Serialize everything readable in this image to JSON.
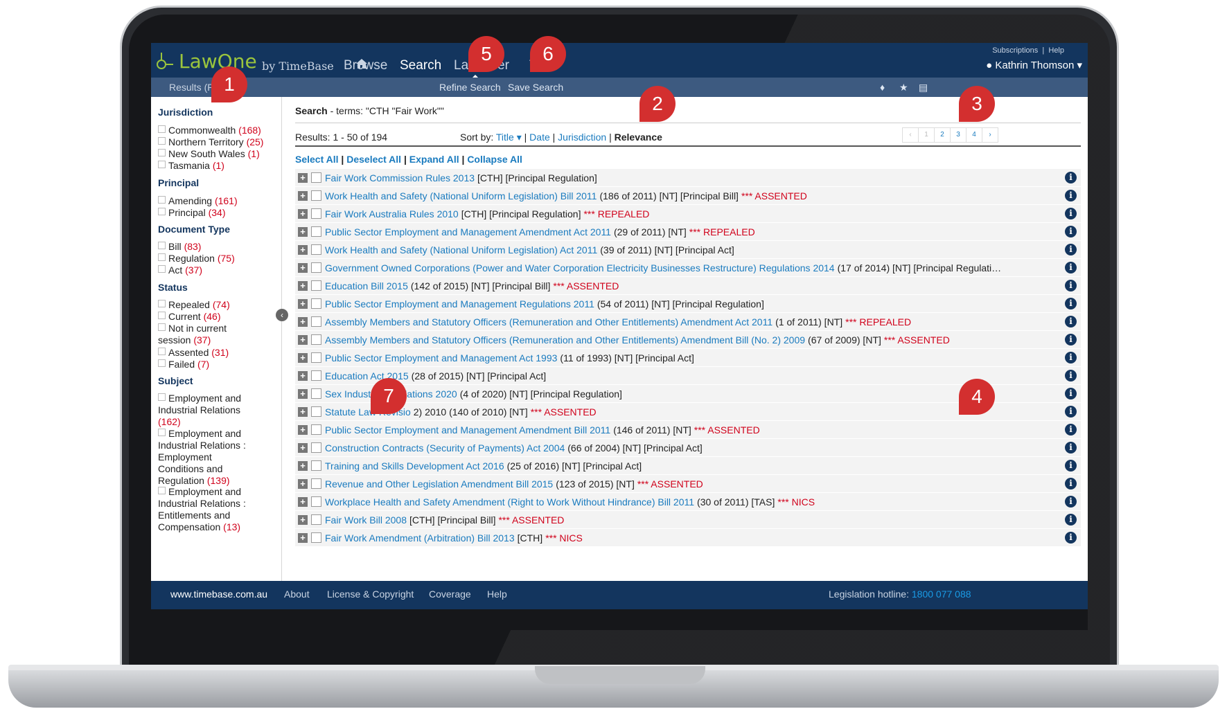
{
  "app": {
    "logo_text": "LawOne",
    "logo_by": "by TimeBase"
  },
  "nav": {
    "items": [
      {
        "label": "Browse"
      },
      {
        "label": "Search"
      },
      {
        "label": "Law"
      },
      {
        "label": "er"
      },
      {
        "label": "T"
      }
    ]
  },
  "toplinks": {
    "subscriptions": "Subscriptions",
    "separator": "|",
    "help": "Help",
    "user": "Kathrin Thomson"
  },
  "subbar": {
    "crumb": "Results (Page 1",
    "refine": "Refine Search",
    "save": "Save Search"
  },
  "sidebar": {
    "groups": [
      {
        "heading": "Jurisdiction",
        "items": [
          {
            "label": "Commonwealth",
            "count": "(168)"
          },
          {
            "label": "Northern Territory",
            "count": "(25)"
          },
          {
            "label": "New South Wales",
            "count": "(1)"
          },
          {
            "label": "Tasmania",
            "count": "(1)"
          }
        ]
      },
      {
        "heading": "Principal",
        "items": [
          {
            "label": "Amending",
            "count": "(161)"
          },
          {
            "label": "Principal",
            "count": "(34)"
          }
        ]
      },
      {
        "heading": "Document Type",
        "items": [
          {
            "label": "Bill",
            "count": "(83)"
          },
          {
            "label": "Regulation",
            "count": "(75)"
          },
          {
            "label": "Act",
            "count": "(37)"
          }
        ]
      },
      {
        "heading": "Status",
        "items": [
          {
            "label": "Repealed",
            "count": "(74)"
          },
          {
            "label": "Current",
            "count": "(46)"
          },
          {
            "label": "Not in current session",
            "count": "(37)"
          },
          {
            "label": "Assented",
            "count": "(31)"
          },
          {
            "label": "Failed",
            "count": "(7)"
          }
        ]
      },
      {
        "heading": "Subject",
        "items": [
          {
            "label": "Employment and Industrial Relations",
            "count": "(162)"
          },
          {
            "label": "Employment and Industrial Relations : Employment Conditions and Regulation",
            "count": "(139)"
          },
          {
            "label": "Employment and Industrial Relations : Entitlements and Compensation",
            "count": "(13)"
          }
        ]
      }
    ]
  },
  "main": {
    "search_label": "Search",
    "search_terms": " - terms: \"CTH \"Fair Work\"\"",
    "results": "Results: 1 - 50 of 194",
    "sort_label": "Sort by:",
    "sort_title": "Title",
    "sort_date": "Date",
    "sort_jurisdiction": "Jurisdiction",
    "sort_relevance": "Relevance",
    "pages": [
      "‹",
      "1",
      "2",
      "3",
      "4",
      "›"
    ],
    "select_all": "Select All",
    "deselect_all": "Deselect All",
    "expand_all": "Expand All",
    "collapse_all": "Collapse All",
    "rows": [
      {
        "title": "Fair Work Commission Rules 2013",
        "meta": "[CTH] [Principal Regulation]",
        "flag": ""
      },
      {
        "title": "Work Health and Safety (National Uniform Legislation) Bill 2011",
        "meta": "(186 of 2011) [NT] [Principal Bill]",
        "flag": "*** ASSENTED"
      },
      {
        "title": "Fair Work Australia Rules 2010",
        "meta": "[CTH] [Principal Regulation]",
        "flag": "*** REPEALED"
      },
      {
        "title": "Public Sector Employment and Management Amendment Act 2011",
        "meta": "(29 of 2011) [NT]",
        "flag": "*** REPEALED"
      },
      {
        "title": "Work Health and Safety (National Uniform Legislation) Act 2011",
        "meta": "(39 of 2011) [NT] [Principal Act]",
        "flag": ""
      },
      {
        "title": "Government Owned Corporations (Power and Water Corporation Electricity Businesses Restructure) Regulations 2014",
        "meta": "(17 of 2014) [NT] [Principal Regulati…",
        "flag": ""
      },
      {
        "title": "Education Bill 2015",
        "meta": "(142 of 2015) [NT] [Principal Bill]",
        "flag": "*** ASSENTED"
      },
      {
        "title": "Public Sector Employment and Management Regulations 2011",
        "meta": "(54 of 2011) [NT] [Principal Regulation]",
        "flag": ""
      },
      {
        "title": "Assembly Members and Statutory Officers (Remuneration and Other Entitlements) Amendment Act 2011",
        "meta": "(1 of 2011) [NT]",
        "flag": "*** REPEALED"
      },
      {
        "title": "Assembly Members and Statutory Officers (Remuneration and Other Entitlements) Amendment Bill (No. 2) 2009",
        "meta": "(67 of 2009) [NT]",
        "flag": "*** ASSENTED"
      },
      {
        "title": "Public Sector Employment and Management Act 1993",
        "meta": "(11 of 1993) [NT] [Principal Act]",
        "flag": ""
      },
      {
        "title": "Education Act 2015",
        "meta": "(28 of 2015) [NT] [Principal Act]",
        "flag": ""
      },
      {
        "title": "Sex Industry Regulations 2020",
        "meta": "(4 of 2020) [NT] [Principal Regulation]",
        "flag": ""
      },
      {
        "title": "Statute Law Revisio",
        "meta": "2) 2010 (140 of 2010) [NT]",
        "flag": "*** ASSENTED"
      },
      {
        "title": "Public Sector Employment and Management Amendment Bill 2011",
        "meta": "(146 of 2011) [NT]",
        "flag": "*** ASSENTED"
      },
      {
        "title": "Construction Contracts (Security of Payments) Act 2004",
        "meta": "(66 of 2004) [NT] [Principal Act]",
        "flag": ""
      },
      {
        "title": "Training and Skills Development Act 2016",
        "meta": "(25 of 2016) [NT] [Principal Act]",
        "flag": ""
      },
      {
        "title": "Revenue and Other Legislation Amendment Bill 2015",
        "meta": "(123 of 2015) [NT]",
        "flag": "*** ASSENTED"
      },
      {
        "title": "Workplace Health and Safety Amendment (Right to Work Without Hindrance) Bill 2011",
        "meta": "(30 of 2011) [TAS]",
        "flag": "*** NICS"
      },
      {
        "title": "Fair Work Bill 2008",
        "meta": "[CTH] [Principal Bill]",
        "flag": "*** ASSENTED"
      },
      {
        "title": "Fair Work Amendment (Arbitration) Bill 2013",
        "meta": "[CTH]",
        "flag": "*** NICS"
      }
    ]
  },
  "footer": {
    "url": "www.timebase.com.au",
    "about": "About",
    "license": "License & Copyright",
    "coverage": "Coverage",
    "help": "Help",
    "hotline_label": "Legislation hotline:",
    "hotline_number": "1800 077 088"
  },
  "callouts": [
    "1",
    "2",
    "3",
    "4",
    "5",
    "6",
    "7"
  ],
  "colors": {
    "nav_bg": "#13355e",
    "subbar_bg": "#3d5a80",
    "link": "#1a7bbf",
    "flag": "#d0021b",
    "logo": "#9bc53d",
    "callout": "#d32f2f"
  },
  "icons": [
    "home-icon",
    "user-icon",
    "caret-down-icon",
    "bell-icon",
    "star-icon",
    "print-icon",
    "chevron-left-icon",
    "plus-icon",
    "info-icon"
  ]
}
